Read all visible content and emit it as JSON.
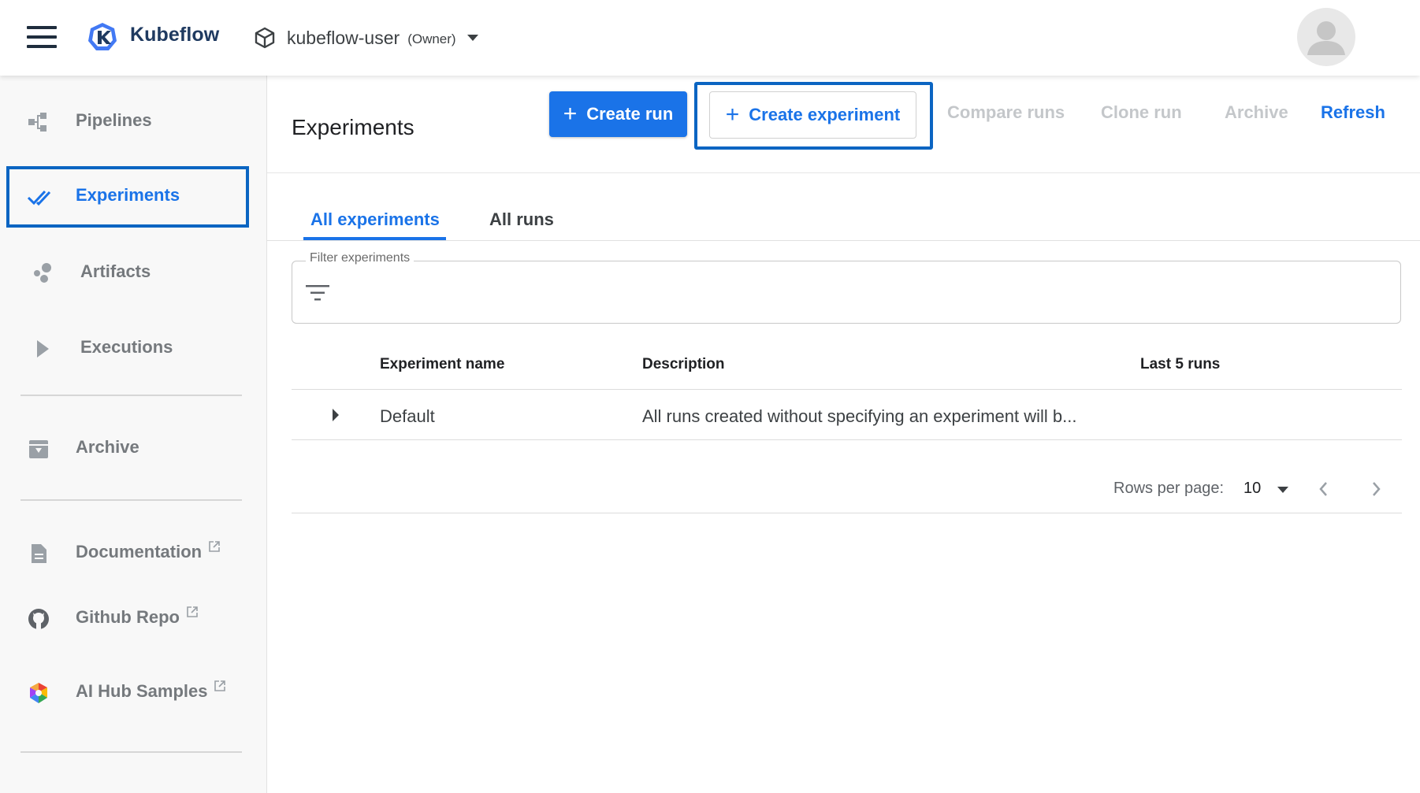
{
  "app": {
    "brand": "Kubeflow",
    "namespace": "kubeflow-user",
    "namespace_role": "(Owner)",
    "accent_color": "#1a73e8",
    "highlight_color": "#0b65c2"
  },
  "sidebar": {
    "items": [
      {
        "label": "Pipelines",
        "icon": "pipelines-icon",
        "active": false
      },
      {
        "label": "Experiments",
        "icon": "experiments-checkmark-icon",
        "active": true
      },
      {
        "label": "Artifacts",
        "icon": "artifacts-icon",
        "active": false
      },
      {
        "label": "Executions",
        "icon": "play-icon",
        "active": false
      },
      {
        "label": "Archive",
        "icon": "archive-icon",
        "active": false
      },
      {
        "label": "Documentation",
        "icon": "document-icon",
        "external": true
      },
      {
        "label": "Github Repo",
        "icon": "github-icon",
        "external": true
      },
      {
        "label": "AI Hub Samples",
        "icon": "ai-hub-icon",
        "external": true
      }
    ]
  },
  "toolbar": {
    "title": "Experiments",
    "create_run": "Create run",
    "create_experiment": "Create experiment",
    "compare_runs": "Compare runs",
    "clone_run": "Clone run",
    "archive": "Archive",
    "refresh": "Refresh"
  },
  "tabs": [
    {
      "label": "All experiments",
      "active": true
    },
    {
      "label": "All runs",
      "active": false
    }
  ],
  "filter": {
    "label": "Filter experiments",
    "value": ""
  },
  "table": {
    "columns": [
      "Experiment name",
      "Description",
      "Last 5 runs"
    ],
    "rows": [
      {
        "name": "Default",
        "description": "All runs created without specifying an experiment will b...",
        "last_runs": ""
      }
    ]
  },
  "pagination": {
    "rows_per_page_label": "Rows per page:",
    "rows_per_page": "10"
  }
}
